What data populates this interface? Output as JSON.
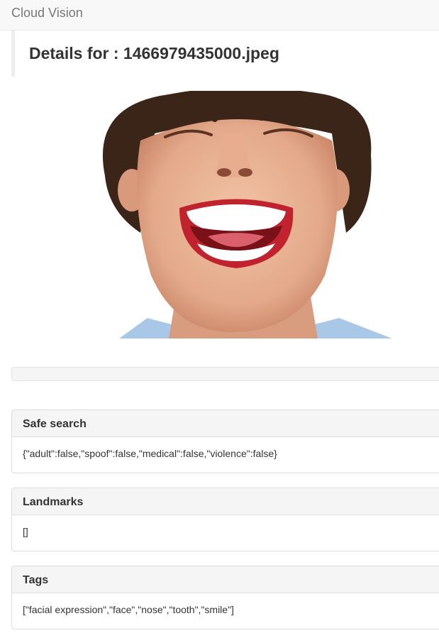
{
  "navbar": {
    "brand": "Cloud Vision"
  },
  "page": {
    "title": "Details for : 1466979435000.jpeg"
  },
  "image": {
    "icon": "photo-laughing-face"
  },
  "panels": [
    {
      "heading": "Safe search",
      "body": "{\"adult\":false,\"spoof\":false,\"medical\":false,\"violence\":false}"
    },
    {
      "heading": "Landmarks",
      "body": "[]"
    },
    {
      "heading": "Tags",
      "body": "[\"facial expression\",\"face\",\"nose\",\"tooth\",\"smile\"]"
    }
  ]
}
